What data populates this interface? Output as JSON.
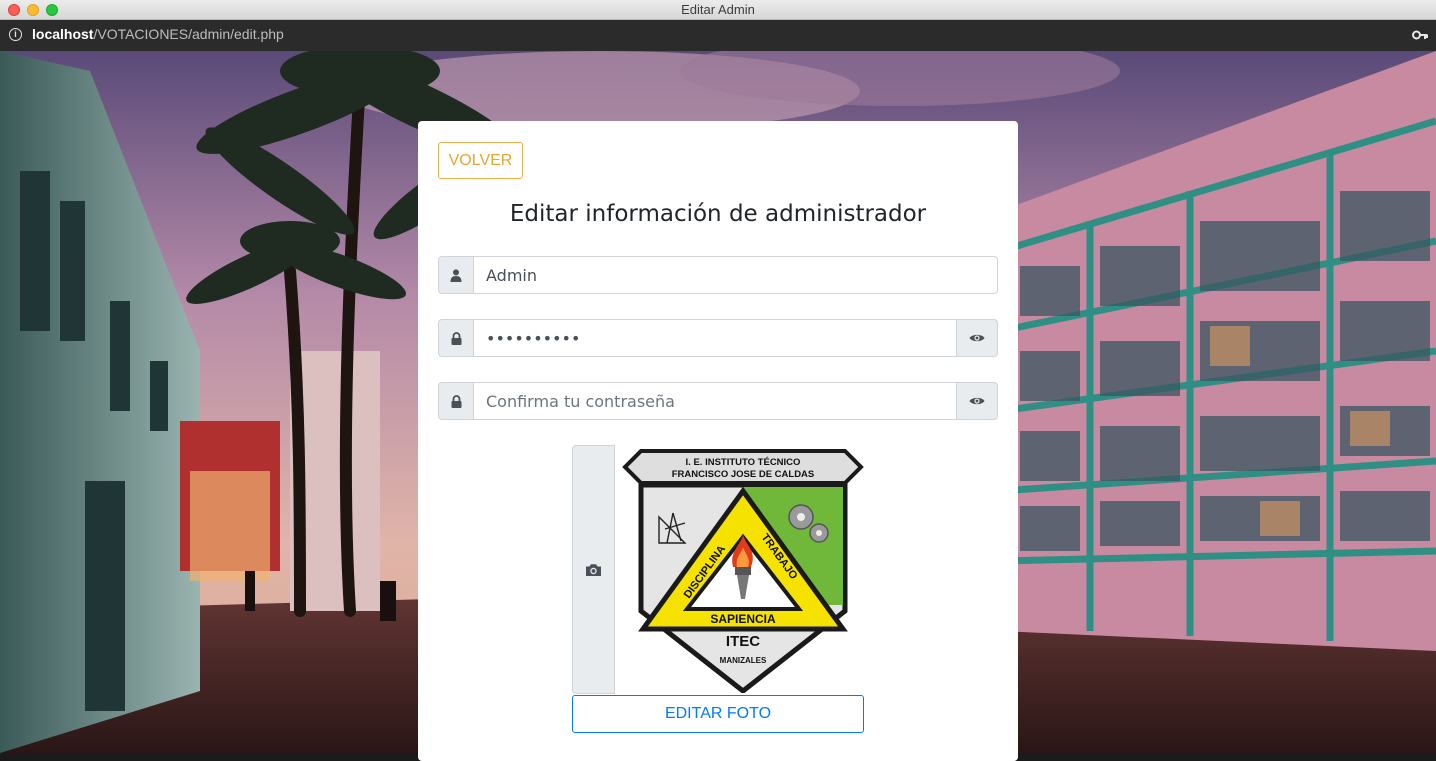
{
  "window": {
    "title": "Editar Admin"
  },
  "addressbar": {
    "host": "localhost",
    "path": "/VOTACIONES/admin/edit.php"
  },
  "form": {
    "back_label": "VOLVER",
    "title": "Editar información de administrador",
    "username_value": "Admin",
    "password_value": "**********",
    "confirm_placeholder": "Confirma tu contraseña",
    "edit_photo_label": "EDITAR FOTO"
  },
  "logo": {
    "banner_line1": "I. E. INSTITUTO TÉCNICO",
    "banner_line2": "FRANCISCO JOSE DE CALDAS",
    "word_left": "DISCIPLINA",
    "word_right": "TRABAJO",
    "word_bottom": "SAPIENCIA",
    "acronym": "ITEC",
    "city": "MANIZALES"
  },
  "icons": {
    "info": "info-icon",
    "key": "key-icon",
    "user": "user-icon",
    "lock": "lock-icon",
    "eye": "eye-icon",
    "camera": "camera-icon"
  },
  "colors": {
    "warning": "#f0ad4e",
    "primary": "#007bff",
    "addon_bg": "#e9ecef"
  }
}
